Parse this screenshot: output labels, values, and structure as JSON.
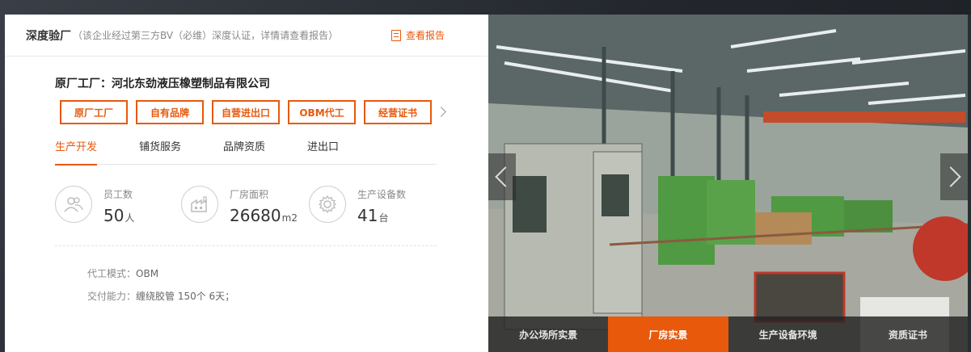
{
  "header": {
    "title": "深度验厂",
    "note": "（该企业经过第三方BV（必维）深度认证，详情请查看报告）",
    "report_label": "查看报告"
  },
  "factory": {
    "name": "原厂工厂：河北东劲液压橡塑制品有限公司"
  },
  "tags": [
    "原厂工厂",
    "自有品牌",
    "自营进出口",
    "OBM代工",
    "经营证书"
  ],
  "subtabs": [
    "生产开发",
    "铺货服务",
    "品牌资质",
    "进出口"
  ],
  "active_subtab": "生产开发",
  "stats": [
    {
      "label": "员工数",
      "value": "50",
      "unit": "人",
      "icon": "people-icon"
    },
    {
      "label": "厂房面积",
      "value": "26680",
      "unit": "m2",
      "icon": "factory-icon"
    },
    {
      "label": "生产设备数",
      "value": "41",
      "unit": "台",
      "icon": "gear-icon"
    }
  ],
  "info": {
    "mode_key": "代工模式：",
    "mode_val": "OBM",
    "capacity_key": "交付能力：",
    "capacity_val": "缠绕胶管 150个 6天；"
  },
  "photo_tabs": [
    "办公场所实景",
    "厂房实景",
    "生产设备环境",
    "资质证书"
  ],
  "active_photo_tab": "厂房实景",
  "colors": {
    "accent": "#e8590c"
  }
}
